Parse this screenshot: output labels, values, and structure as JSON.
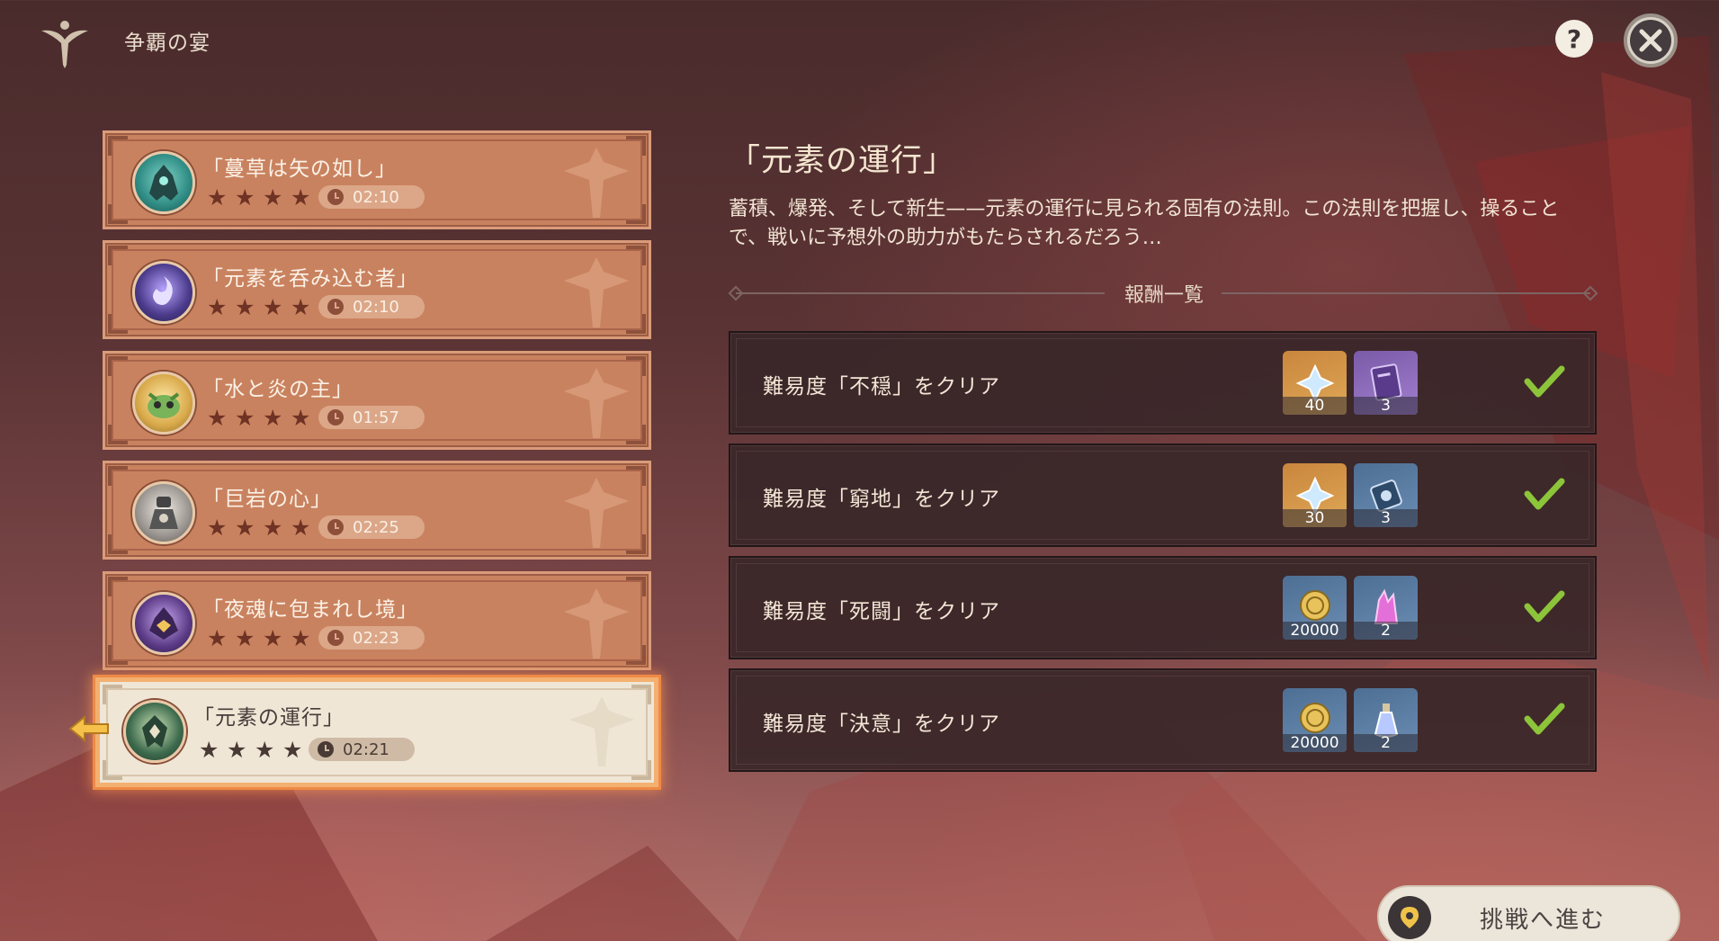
{
  "header": {
    "title": "争覇の宴",
    "emblem_icon": "event-emblem-icon",
    "help_label": "?",
    "close_icon": "close-icon"
  },
  "challenges": [
    {
      "name": "「蔓草は矢の如し」",
      "stars": 4,
      "time": "02:10",
      "avatar_color": "#2f8c84",
      "selected": false
    },
    {
      "name": "「元素を呑み込む者」",
      "stars": 4,
      "time": "02:10",
      "avatar_color": "#4a3a8a",
      "selected": false
    },
    {
      "name": "「水と炎の主」",
      "stars": 4,
      "time": "01:57",
      "avatar_color": "#d8a94a",
      "selected": false
    },
    {
      "name": "「巨岩の心」",
      "stars": 4,
      "time": "02:25",
      "avatar_color": "#9a9590",
      "selected": false
    },
    {
      "name": "「夜魂に包まれし境」",
      "stars": 4,
      "time": "02:23",
      "avatar_color": "#5b3a86",
      "selected": false
    },
    {
      "name": "「元素の運行」",
      "stars": 4,
      "time": "02:21",
      "avatar_color": "#3d6a4d",
      "selected": true
    }
  ],
  "detail": {
    "title": "「元素の運行」",
    "description": "蓄積、爆発、そして新生——元素の運行に見られる固有の法則。この法則を把握し、操ることで、戦いに予想外の助力がもたらされるだろう…",
    "rewards_label": "報酬一覧",
    "rewards": [
      {
        "label": "難易度「不穏」をクリア",
        "completed": true,
        "items": [
          {
            "icon": "primogem-icon",
            "count": "40",
            "bg": "gold"
          },
          {
            "icon": "heros-wit-book-icon",
            "count": "3",
            "bg": "purple"
          }
        ]
      },
      {
        "label": "難易度「窮地」をクリア",
        "completed": true,
        "items": [
          {
            "icon": "primogem-icon",
            "count": "30",
            "bg": "gold"
          },
          {
            "icon": "weapon-ore-scroll-icon",
            "count": "3",
            "bg": "blue"
          }
        ]
      },
      {
        "label": "難易度「死闘」をクリア",
        "completed": true,
        "items": [
          {
            "icon": "mora-icon",
            "count": "20000",
            "bg": "blue"
          },
          {
            "icon": "crystal-chunk-icon",
            "count": "2",
            "bg": "blue"
          }
        ]
      },
      {
        "label": "難易度「決意」をクリア",
        "completed": true,
        "items": [
          {
            "icon": "mora-icon",
            "count": "20000",
            "bg": "blue"
          },
          {
            "icon": "potion-icon",
            "count": "2",
            "bg": "blue"
          }
        ]
      }
    ]
  },
  "start_button": {
    "label": "挑戦へ進む",
    "icon": "location-pin-icon"
  }
}
